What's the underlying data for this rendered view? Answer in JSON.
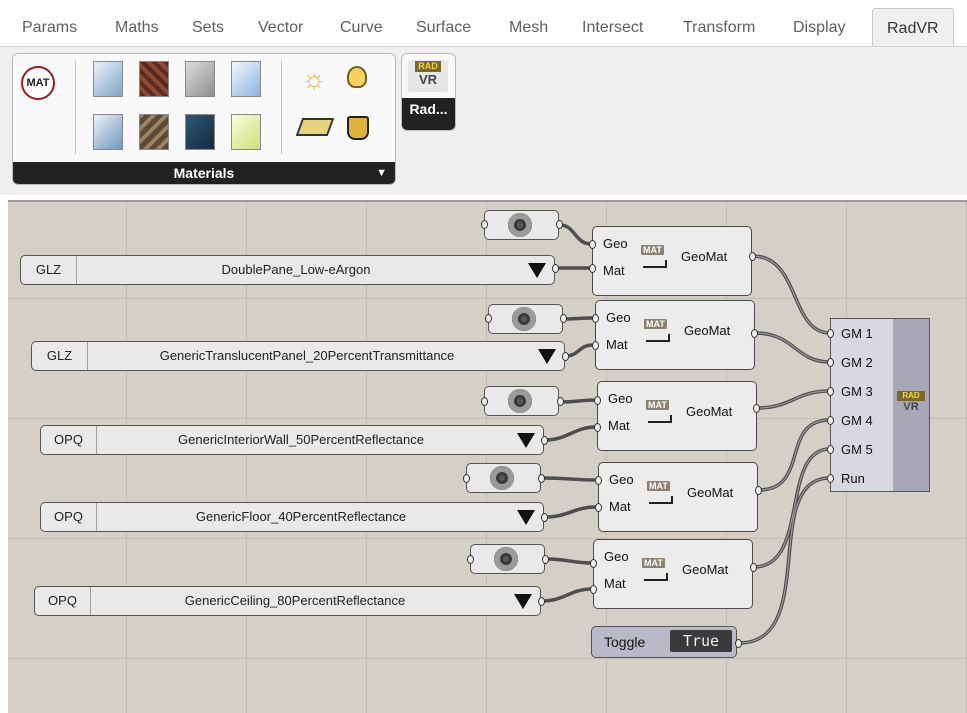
{
  "tabs": [
    {
      "label": "Params",
      "active": false
    },
    {
      "label": "Maths",
      "active": false
    },
    {
      "label": "Sets",
      "active": false
    },
    {
      "label": "Vector",
      "active": false
    },
    {
      "label": "Curve",
      "active": false
    },
    {
      "label": "Surface",
      "active": false
    },
    {
      "label": "Mesh",
      "active": false
    },
    {
      "label": "Intersect",
      "active": false
    },
    {
      "label": "Transform",
      "active": false
    },
    {
      "label": "Display",
      "active": false
    },
    {
      "label": "RadVR",
      "active": true
    }
  ],
  "ribbon": {
    "materials_panel": {
      "title": "Materials",
      "mat_icon_label": "MAT"
    },
    "radvr_panel": {
      "badge_top": "RAD",
      "badge_bottom": "VR",
      "label": "Rad..."
    }
  },
  "canvas": {
    "geomat": {
      "in_geo": "Geo",
      "in_mat": "Mat",
      "out": "GeoMat",
      "badge": "MAT"
    },
    "materials": [
      {
        "type": "GLZ",
        "value": "DoublePane_Low-eArgon"
      },
      {
        "type": "GLZ",
        "value": "GenericTranslucentPanel_20PercentTransmittance"
      },
      {
        "type": "OPQ",
        "value": "GenericInteriorWall_50PercentReflectance"
      },
      {
        "type": "OPQ",
        "value": "GenericFloor_40PercentReflectance"
      },
      {
        "type": "OPQ",
        "value": "GenericCeiling_80PercentReflectance"
      }
    ],
    "radvr": {
      "inputs": [
        "GM 1",
        "GM 2",
        "GM 3",
        "GM 4",
        "GM 5",
        "Run"
      ],
      "badge_top": "RAD",
      "badge_bottom": "VR"
    },
    "toggle": {
      "label": "Toggle",
      "value": "True"
    }
  },
  "colors": {
    "canvas_bg": "#d4d0c8",
    "node_bg": "#ececec",
    "wire": "#4a4a4a",
    "radvr_body": "#a7a7b7"
  }
}
